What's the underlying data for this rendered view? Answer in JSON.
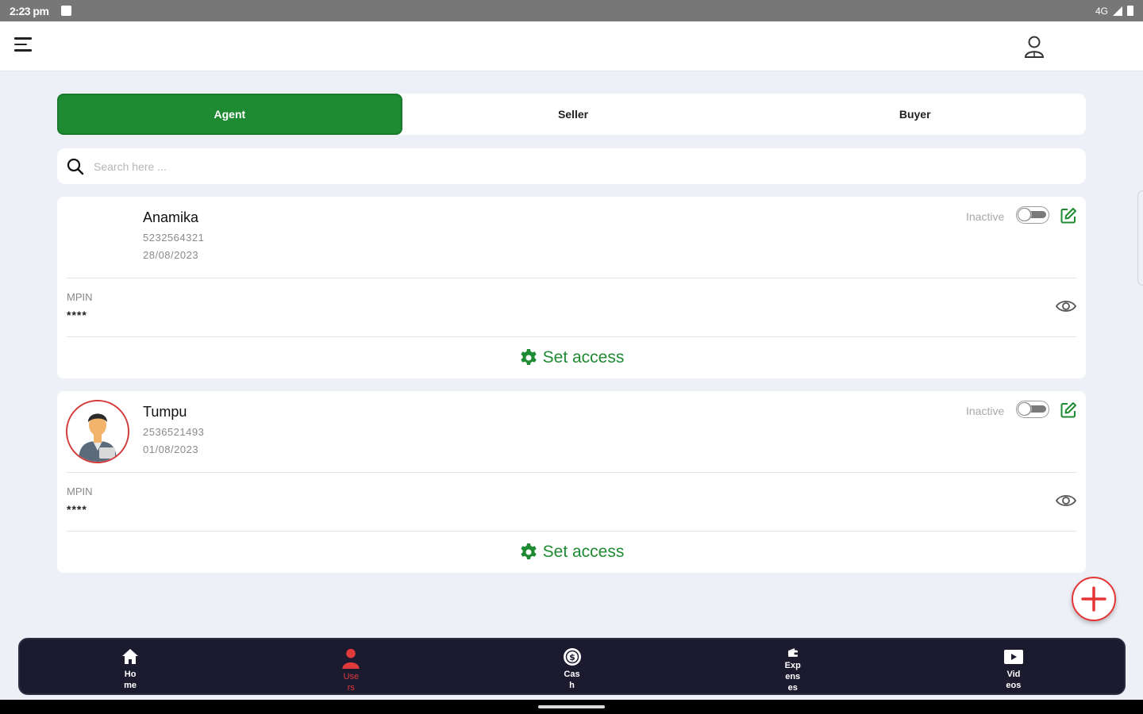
{
  "status_bar": {
    "time": "2:23 pm",
    "network": "4G"
  },
  "tabs": [
    {
      "label": "Agent",
      "active": true
    },
    {
      "label": "Seller",
      "active": false
    },
    {
      "label": "Buyer",
      "active": false
    }
  ],
  "search": {
    "placeholder": "Search here ..."
  },
  "users": [
    {
      "name": "Anamika",
      "phone": "5232564321",
      "date": "28/08/2023",
      "status_label": "Inactive",
      "active": false,
      "mpin_label": "MPIN",
      "mpin_value": "****",
      "access_label": "Set access",
      "has_photo": false
    },
    {
      "name": "Tumpu",
      "phone": "2536521493",
      "date": "01/08/2023",
      "status_label": "Inactive",
      "active": false,
      "mpin_label": "MPIN",
      "mpin_value": "****",
      "access_label": "Set access",
      "has_photo": true
    }
  ],
  "bottom_nav": [
    {
      "label": "Home",
      "icon": "home-icon",
      "active": false
    },
    {
      "label": "Users",
      "icon": "user-icon",
      "active": true
    },
    {
      "label": "Cash",
      "icon": "cash-icon",
      "active": false
    },
    {
      "label": "Expenses",
      "icon": "expenses-icon",
      "active": false
    },
    {
      "label": "Videos",
      "icon": "video-icon",
      "active": false
    }
  ],
  "colors": {
    "primary_green": "#1e8a32",
    "accent_red": "#e53535",
    "nav_bg": "#1c1a2e"
  }
}
